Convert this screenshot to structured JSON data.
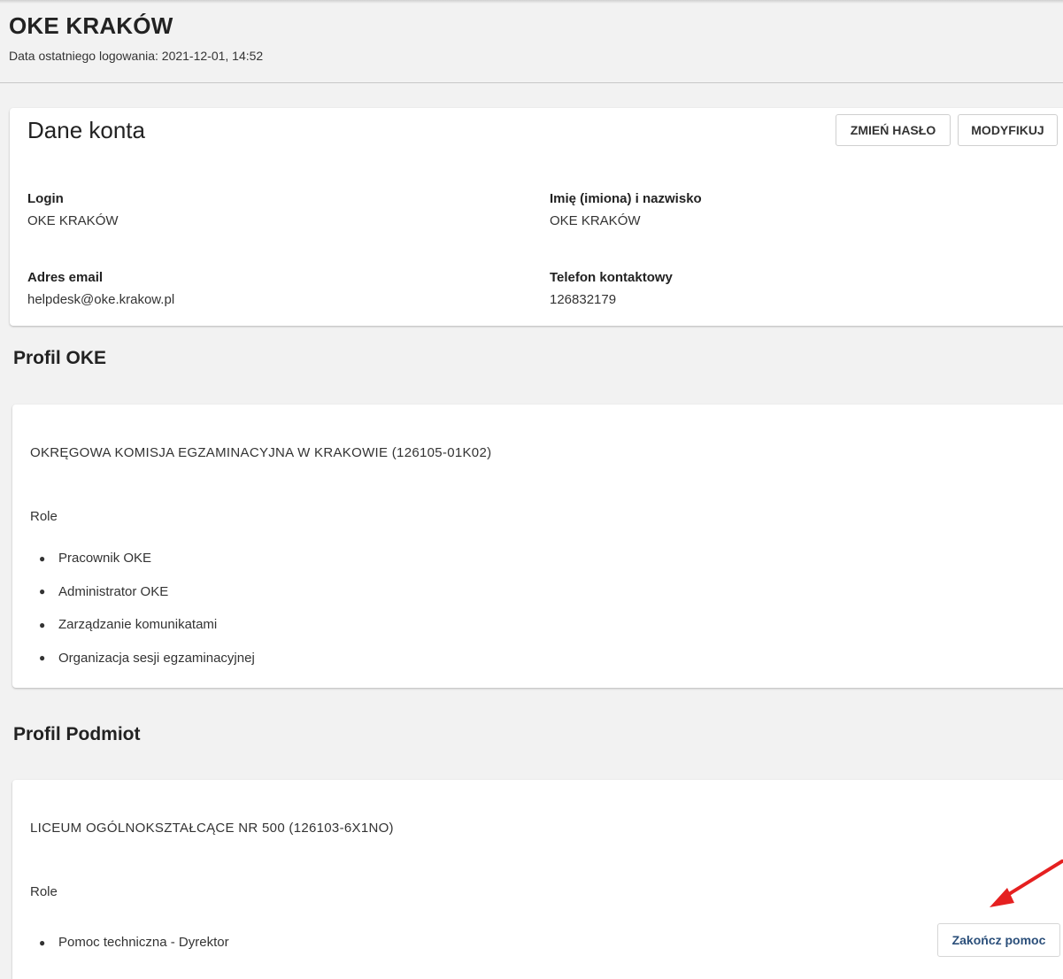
{
  "header": {
    "title": "OKE KRAKÓW",
    "last_login": "Data ostatniego logowania: 2021-12-01, 14:52"
  },
  "account": {
    "title": "Dane konta",
    "change_password_label": "ZMIEŃ HASŁO",
    "modify_label": "MODYFIKUJ",
    "fields": [
      {
        "label": "Login",
        "value": "OKE KRAKÓW"
      },
      {
        "label": "Imię (imiona) i nazwisko",
        "value": "OKE KRAKÓW"
      },
      {
        "label": "Adres email",
        "value": "helpdesk@oke.krakow.pl"
      },
      {
        "label": "Telefon kontaktowy",
        "value": "126832179"
      }
    ]
  },
  "profile_oke": {
    "section_title": "Profil OKE",
    "org_name": "OKRĘGOWA KOMISJA EGZAMINACYJNA W KRAKOWIE (126105-01K02)",
    "roles_label": "Role",
    "roles": [
      "Pracownik OKE",
      "Administrator OKE",
      "Zarządzanie komunikatami",
      "Organizacja sesji egzaminacyjnej"
    ]
  },
  "profile_podmiot": {
    "section_title": "Profil Podmiot",
    "org_name": "LICEUM OGÓLNOKSZTAŁCĄCE NR 500 (126103-6X1NO)",
    "roles_label": "Role",
    "roles": [
      "Pomoc techniczna - Dyrektor"
    ],
    "end_help_label": "Zakończ pomoc"
  },
  "colors": {
    "background": "#f2f2f2",
    "card": "#ffffff",
    "help_button_text": "#2b4f7a",
    "annotation_arrow": "#e52020"
  },
  "icons": {
    "annotation": "red-arrow-icon",
    "bullet": "bullet-icon"
  }
}
